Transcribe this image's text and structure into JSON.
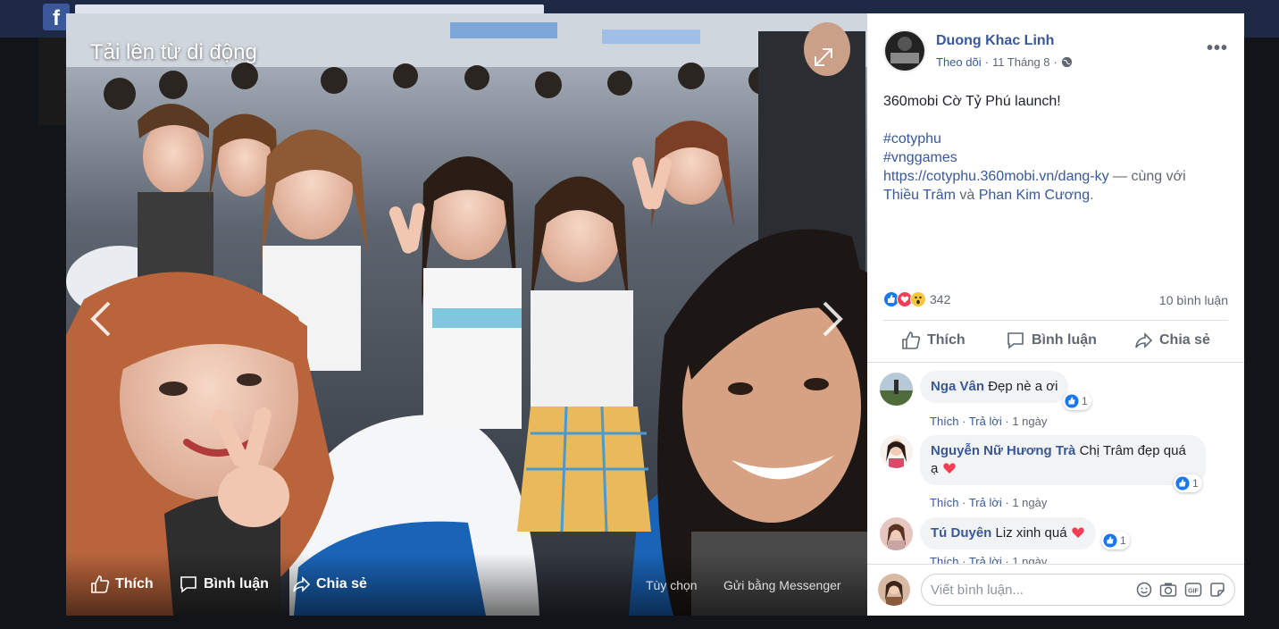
{
  "viewer": {
    "caption": "Tải lên từ di động",
    "actions": {
      "like": "Thích",
      "comment": "Bình luận",
      "share": "Chia sẻ"
    },
    "options": "Tùy chọn",
    "messenger": "Gửi bằng Messenger"
  },
  "post": {
    "author": "Duong Khac Linh",
    "follow": "Theo dõi",
    "date": "11 Tháng 8",
    "text_line1": "360mobi Cờ Tỷ Phú launch!",
    "hashtag1": "#cotyphu",
    "hashtag2": "#vnggames",
    "link": "https://cotyphu.360mobi.vn/dang-ky",
    "with_text": " — cùng với",
    "tag1": "Thiều Trâm",
    "and_text": " và ",
    "tag2": "Phan Kim Cương",
    "period": ".",
    "reaction_count": "342",
    "comment_count": "10 bình luận",
    "actions": {
      "like": "Thích",
      "comment": "Bình luận",
      "share": "Chia sẻ"
    }
  },
  "comments": [
    {
      "author": "Nga Vân",
      "text": "Đẹp nè a ơi",
      "like": "Thích",
      "reply": "Trả lời",
      "time": "1 ngày",
      "reactions": "1"
    },
    {
      "author": "Nguyễn Nữ Hương Trà",
      "text": "Chị Trâm đẹp quá ạ",
      "like": "Thích",
      "reply": "Trả lời",
      "time": "1 ngày",
      "reactions": "1"
    },
    {
      "author": "Tú Duyên",
      "text": "Liz xinh quá",
      "like": "Thích",
      "reply": "Trả lời",
      "time": "1 ngày",
      "reactions": "1"
    }
  ],
  "reply": {
    "placeholder": "Viết bình luận..."
  },
  "colors": {
    "link_blue": "#385898",
    "like_blue": "#1877f2",
    "heart_red": "#f33e58"
  }
}
